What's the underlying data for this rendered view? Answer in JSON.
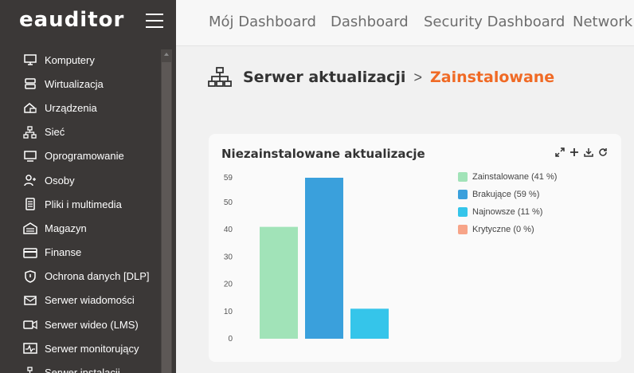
{
  "app": {
    "logo": "eauditor"
  },
  "sidebar": {
    "items": [
      {
        "label": "Komputery",
        "icon": "monitor-icon"
      },
      {
        "label": "Wirtualizacja",
        "icon": "server-icon"
      },
      {
        "label": "Urządzenia",
        "icon": "devices-icon"
      },
      {
        "label": "Sieć",
        "icon": "network-icon"
      },
      {
        "label": "Oprogramowanie",
        "icon": "software-icon"
      },
      {
        "label": "Osoby",
        "icon": "users-icon"
      },
      {
        "label": "Pliki i multimedia",
        "icon": "files-icon"
      },
      {
        "label": "Magazyn",
        "icon": "warehouse-icon"
      },
      {
        "label": "Finanse",
        "icon": "card-icon"
      },
      {
        "label": "Ochrona danych [DLP]",
        "icon": "shield-icon"
      },
      {
        "label": "Serwer wiadomości",
        "icon": "mail-icon"
      },
      {
        "label": "Serwer wideo (LMS)",
        "icon": "video-icon"
      },
      {
        "label": "Serwer monitorujący",
        "icon": "monitoring-icon"
      },
      {
        "label": "Serwer instalacji",
        "icon": "install-icon"
      }
    ]
  },
  "topnav": {
    "tabs": [
      "Mój Dashboard",
      "Dashboard",
      "Security Dashboard",
      "Network Das"
    ]
  },
  "breadcrumb": {
    "parent": "Serwer aktualizacji",
    "separator": ">",
    "current": "Zainstalowane"
  },
  "colors": {
    "accent": "#f06a25",
    "sidebar_bg": "#3b3837",
    "installed": "#a1e3b8",
    "missing": "#3aa0dc",
    "newest": "#35c5ea",
    "critical": "#f7a488"
  },
  "card": {
    "title": "Niezainstalowane aktualizacje",
    "tools": [
      "expand-icon",
      "plus-icon",
      "download-icon",
      "refresh-icon"
    ]
  },
  "chart_data": {
    "type": "bar",
    "title": "Niezainstalowane aktualizacje",
    "categories": [
      "Zainstalowane",
      "Brakujące",
      "Najnowsze",
      "Krytyczne"
    ],
    "values": [
      41,
      59,
      11,
      0
    ],
    "yticks": [
      "0",
      "10",
      "20",
      "30",
      "40",
      "50",
      "59"
    ],
    "ylim": [
      0,
      59
    ],
    "legend": [
      {
        "label": "Zainstalowane (41 %)",
        "color": "#a1e3b8"
      },
      {
        "label": "Brakujące (59 %)",
        "color": "#3aa0dc"
      },
      {
        "label": "Najnowsze (11 %)",
        "color": "#35c5ea"
      },
      {
        "label": "Krytyczne (0 %)",
        "color": "#f7a488"
      }
    ],
    "legend_position": "right",
    "grid": false
  }
}
